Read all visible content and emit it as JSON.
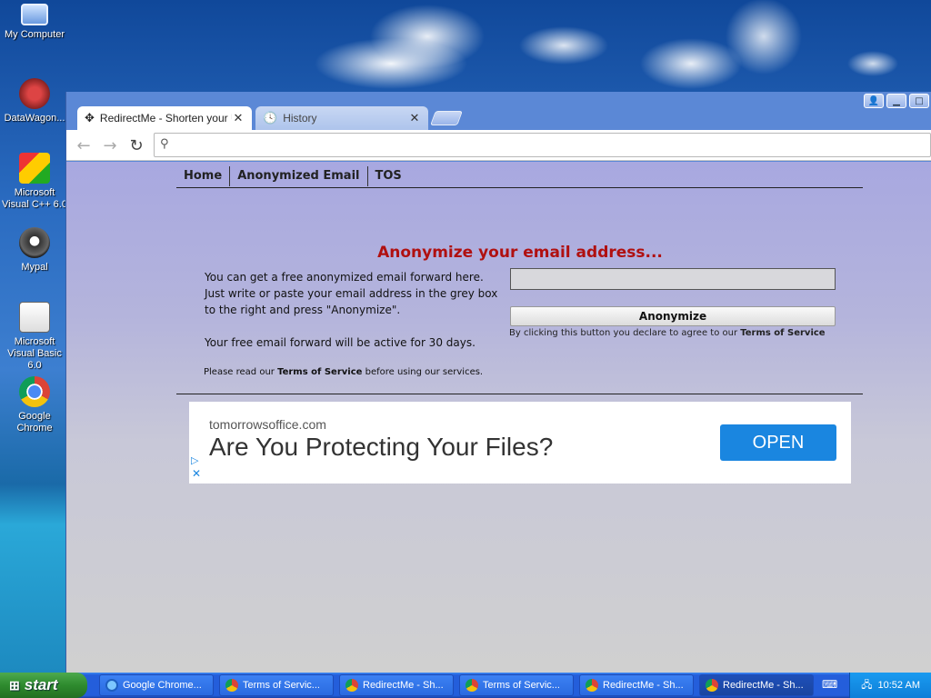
{
  "desktop": {
    "icons": [
      {
        "label": "My Computer",
        "icon": "computer-icon"
      },
      {
        "label": "DataWagon...",
        "icon": "datawagon-icon"
      },
      {
        "label": "Microsoft Visual C++ 6.0",
        "icon": "visual-cpp-icon"
      },
      {
        "label": "Mypal",
        "icon": "mypal-icon"
      },
      {
        "label": "Microsoft Visual Basic 6.0",
        "icon": "visual-basic-icon"
      },
      {
        "label": "Google Chrome",
        "icon": "chrome-icon"
      }
    ]
  },
  "browser": {
    "tabs": [
      {
        "label": "RedirectMe - Shorten your U",
        "icon": "move-icon",
        "active": true
      },
      {
        "label": "History",
        "icon": "history-icon",
        "active": false
      }
    ],
    "address": ""
  },
  "page": {
    "nav": [
      "Home",
      "Anonymized Email",
      "TOS"
    ],
    "heading": "Anonymize your email address...",
    "desc1": "You can get a free anonymized email forward here. Just write or paste your email address in the grey box to the right and press \"Anonymize\".",
    "desc2": "Your free email forward will be active for 30 days.",
    "notice_pre": "Please read our ",
    "notice_link": "Terms of Service",
    "notice_post": " before using our services.",
    "email_value": "",
    "button_label": "Anonymize",
    "agree_pre": "By clicking this button you declare to agree to our ",
    "agree_link": "Terms of Service"
  },
  "ad": {
    "domain": "tomorrowsoffice.com",
    "headline": "Are You Protecting Your Files?",
    "button": "OPEN"
  },
  "taskbar": {
    "start": "start",
    "items": [
      {
        "label": "Google Chrome...",
        "icon": "ie-icon"
      },
      {
        "label": "Terms of Servic...",
        "icon": "chrome-icon"
      },
      {
        "label": "RedirectMe - Sh...",
        "icon": "chrome-icon"
      },
      {
        "label": "Terms of Servic...",
        "icon": "chrome-icon"
      },
      {
        "label": "RedirectMe - Sh...",
        "icon": "chrome-icon"
      },
      {
        "label": "RedirectMe - Sh...",
        "icon": "chrome-icon"
      }
    ],
    "clock": "10:52 AM"
  }
}
